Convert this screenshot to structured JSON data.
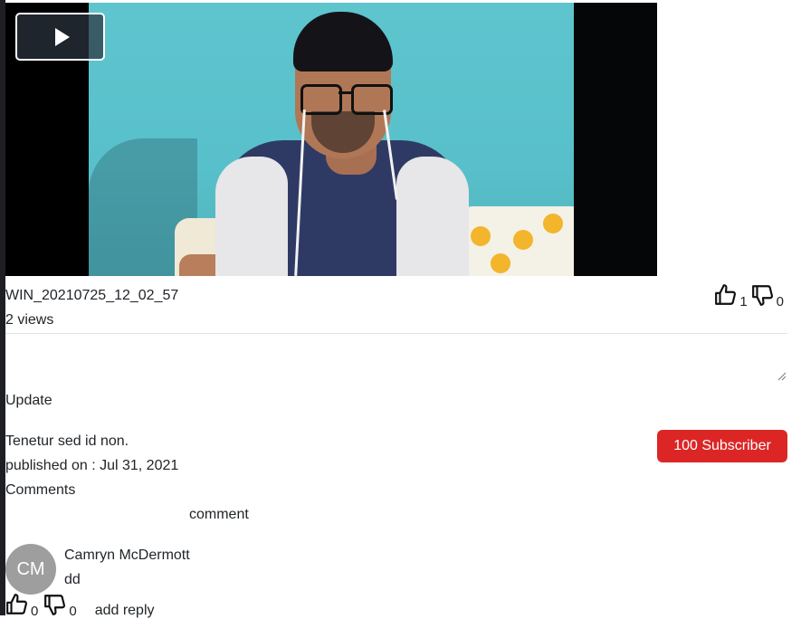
{
  "video": {
    "play_icon": "play-icon",
    "title": "WIN_20210725_12_02_57",
    "views": "2 views",
    "likes": "1",
    "dislikes": "0"
  },
  "editor": {
    "textarea_value": "",
    "update_label": "Update"
  },
  "details": {
    "description": "Tenetur sed id non.",
    "published": "published on : Jul 31, 2021",
    "subscribe_label": "100 Subscriber",
    "subscribe_color": "#dc2626"
  },
  "comments": {
    "heading": "Comments",
    "input_label": "comment",
    "items": [
      {
        "initials": "CM",
        "author": "Camryn McDermott",
        "text": "dd",
        "likes": "0",
        "dislikes": "0",
        "reply_label": "add reply"
      }
    ]
  }
}
